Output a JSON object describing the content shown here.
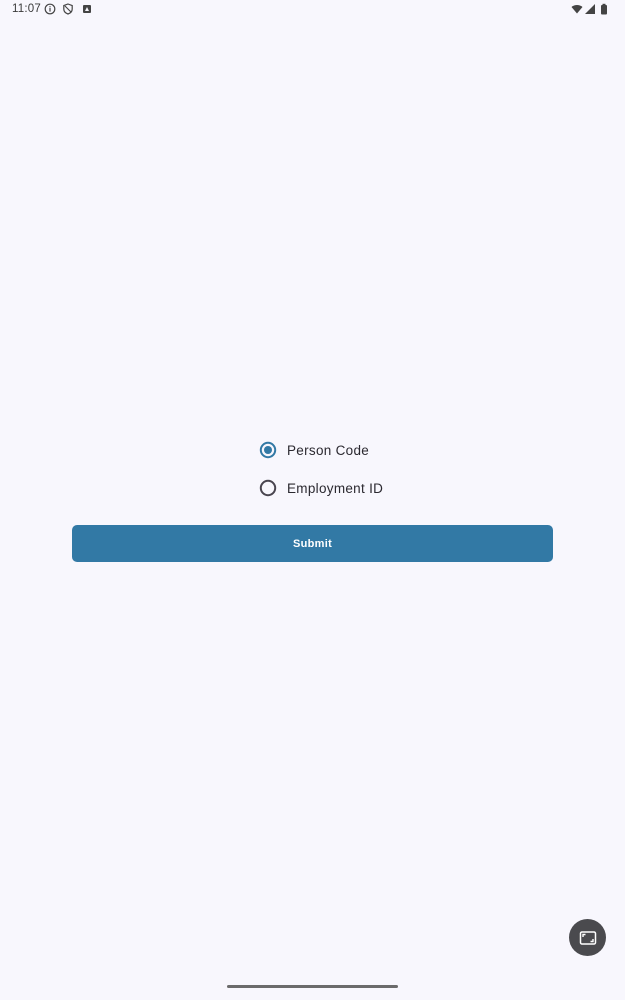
{
  "status_bar": {
    "time": "11:07",
    "left_icons": [
      "info-icon",
      "shield-icon",
      "app-notification-icon"
    ],
    "right_icons": [
      "wifi-icon",
      "signal-icon",
      "battery-icon"
    ]
  },
  "id_type": {
    "options": [
      {
        "label": "Person Code",
        "selected": true
      },
      {
        "label": "Employment ID",
        "selected": false
      }
    ]
  },
  "submit": {
    "label": "Submit"
  },
  "floating_button": {
    "icon": "picture-in-picture-icon"
  },
  "colors": {
    "background": "#f8f7fd",
    "accent": "#3279a5",
    "fab": "#4a4a4e"
  }
}
